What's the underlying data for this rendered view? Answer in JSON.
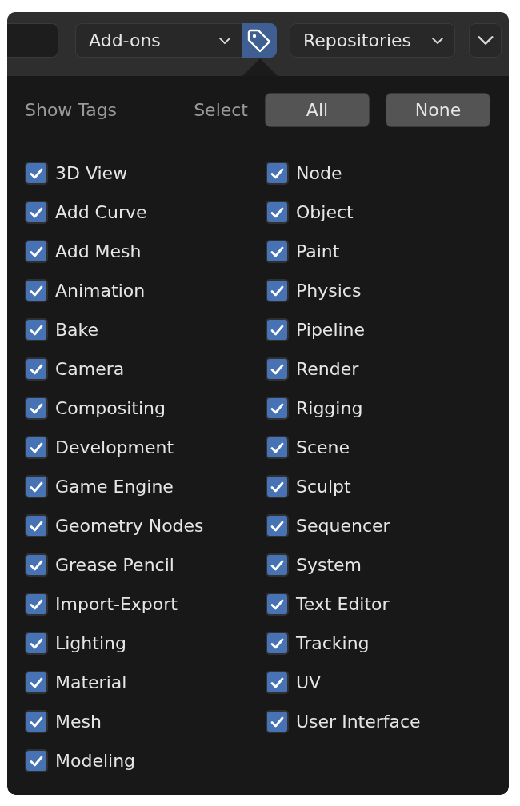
{
  "header": {
    "category_dropdown": {
      "value": "Add-ons"
    },
    "tags_button": {
      "selected": true
    },
    "repository_dropdown": {
      "value": "Repositories"
    }
  },
  "popup": {
    "title": "Show Tags",
    "select_label": "Select",
    "buttons": [
      "All",
      "None"
    ],
    "tags": [
      {
        "label": "3D View",
        "checked": true
      },
      {
        "label": "Add Curve",
        "checked": true
      },
      {
        "label": "Add Mesh",
        "checked": true
      },
      {
        "label": "Animation",
        "checked": true
      },
      {
        "label": "Bake",
        "checked": true
      },
      {
        "label": "Camera",
        "checked": true
      },
      {
        "label": "Compositing",
        "checked": true
      },
      {
        "label": "Development",
        "checked": true
      },
      {
        "label": "Game Engine",
        "checked": true
      },
      {
        "label": "Geometry Nodes",
        "checked": true
      },
      {
        "label": "Grease Pencil",
        "checked": true
      },
      {
        "label": "Import-Export",
        "checked": true
      },
      {
        "label": "Lighting",
        "checked": true
      },
      {
        "label": "Material",
        "checked": true
      },
      {
        "label": "Mesh",
        "checked": true
      },
      {
        "label": "Modeling",
        "checked": true
      },
      {
        "label": "Node",
        "checked": true
      },
      {
        "label": "Object",
        "checked": true
      },
      {
        "label": "Paint",
        "checked": true
      },
      {
        "label": "Physics",
        "checked": true
      },
      {
        "label": "Pipeline",
        "checked": true
      },
      {
        "label": "Render",
        "checked": true
      },
      {
        "label": "Rigging",
        "checked": true
      },
      {
        "label": "Scene",
        "checked": true
      },
      {
        "label": "Sculpt",
        "checked": true
      },
      {
        "label": "Sequencer",
        "checked": true
      },
      {
        "label": "System",
        "checked": true
      },
      {
        "label": "Text Editor",
        "checked": true
      },
      {
        "label": "Tracking",
        "checked": true
      },
      {
        "label": "UV",
        "checked": true
      },
      {
        "label": "User Interface",
        "checked": true
      }
    ]
  }
}
